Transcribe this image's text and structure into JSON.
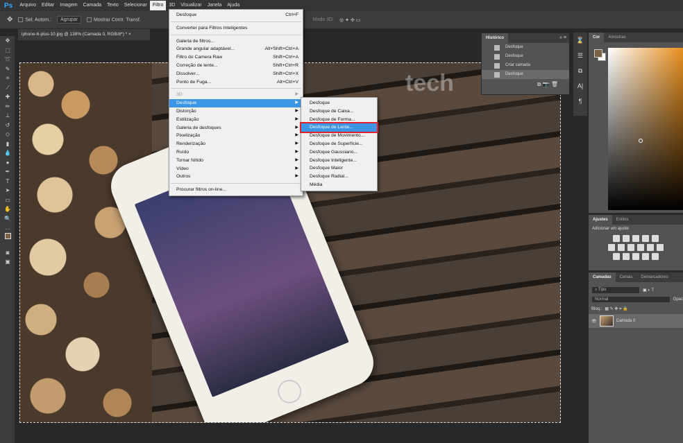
{
  "menubar": {
    "logo": "Ps",
    "items": [
      "Arquivo",
      "Editar",
      "Imagem",
      "Camada",
      "Texto",
      "Selecionar",
      "Filtro",
      "3D",
      "Visualizar",
      "Janela",
      "Ajuda"
    ],
    "active": "Filtro"
  },
  "options": {
    "auto_select": "Sel. Autom.:",
    "group": "Agrupar",
    "show_transform": "Mostrar Contr. Transf.",
    "mode3d": "Modo 3D:"
  },
  "document": {
    "tab": "iphone-6-plus-10.jpg @ 138% (Camada 0, RGB/8*) *",
    "close": "×",
    "watermark": "tech"
  },
  "filter_menu": {
    "last": {
      "label": "Desfoque",
      "shortcut": "Ctrl+F"
    },
    "convert": "Converter para Filtros Inteligentes",
    "group1": [
      {
        "label": "Galeria de filtros...",
        "shortcut": ""
      },
      {
        "label": "Grande angular adaptável...",
        "shortcut": "Alt+Shift+Ctrl+A"
      },
      {
        "label": "Filtro do Camera Raw",
        "shortcut": "Shift+Ctrl+A"
      },
      {
        "label": "Correção de lente...",
        "shortcut": "Shift+Ctrl+R"
      },
      {
        "label": "Dissolver...",
        "shortcut": "Shift+Ctrl+X"
      },
      {
        "label": "Ponto de Fuga...",
        "shortcut": "Alt+Ctrl+V"
      }
    ],
    "submenus": [
      "3D",
      "Desfoque",
      "Distorção",
      "Estilização",
      "Galeria de desfoques",
      "Pixelização",
      "Renderização",
      "Ruído",
      "Tornar Nítido",
      "Vídeo",
      "Outros"
    ],
    "highlighted": "Desfoque",
    "browse": "Procurar filtros on-line..."
  },
  "blur_submenu": {
    "items": [
      "Desfoque",
      "Desfoque de Caixa...",
      "Desfoque de Forma...",
      "Desfoque de Lente...",
      "Desfoque de Movimento...",
      "Desfoque de Superfície...",
      "Desfoque Gaussiano...",
      "Desfoque Inteligente...",
      "Desfoque Maior",
      "Desfoque Radial...",
      "Média"
    ],
    "highlighted": "Desfoque de Lente..."
  },
  "history": {
    "title": "Histórico",
    "items": [
      "Desfoque",
      "Desfoque",
      "Criar camada",
      "Desfoque"
    ]
  },
  "color": {
    "tabs": [
      "Cor",
      "Amostras"
    ],
    "foreground": "#7a6244",
    "background": "#ffffff",
    "hue": "#e88f1d"
  },
  "adjustments": {
    "tabs": [
      "Ajustes",
      "Estilos"
    ],
    "hint": "Adicionar um ajuste"
  },
  "layers": {
    "tabs": [
      "Camadas",
      "Canais",
      "Demarcadores"
    ],
    "filter": "Tipo",
    "blend": "Normal",
    "opacity_label": "Opac",
    "lock_label": "Bloq.:",
    "layer": "Camada 0"
  }
}
